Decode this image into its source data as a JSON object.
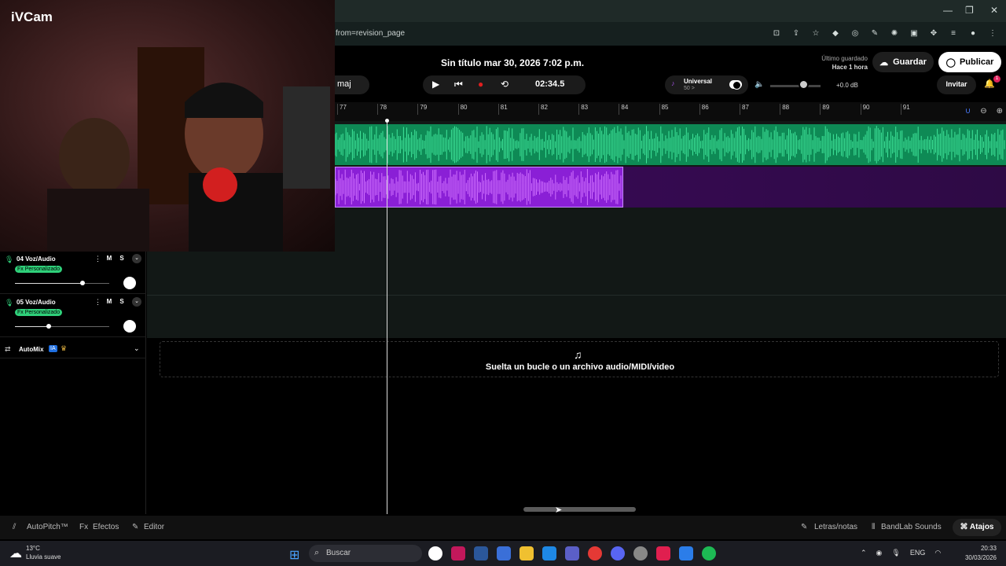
{
  "webcam": {
    "logo": "iVCam"
  },
  "browser": {
    "url": "from=revision_page",
    "minimize": "—",
    "restore": "❐",
    "close": "✕"
  },
  "header": {
    "title": "Sin título mar 30, 2026 7:02 p.m.",
    "saved_label": "Último guardado",
    "saved_time": "Hace 1 hora",
    "save_button": "Guardar",
    "publish_button": "Publicar",
    "key": "maj",
    "time": "02:34.5",
    "preset_name": "Universal",
    "preset_value": "50 >",
    "volume_db": "+0.0 dB",
    "volume_level": 0.6,
    "invite_button": "Invitar",
    "notif_count": "1"
  },
  "ruler": {
    "ticks": [
      "77",
      "78",
      "79",
      "80",
      "81",
      "82",
      "83",
      "84",
      "85",
      "86",
      "87",
      "88",
      "89",
      "90",
      "91"
    ]
  },
  "tracks": [
    {
      "name": "04  Voz/Audio",
      "fx": "Fx Personalizado",
      "mute": "M",
      "solo": "S",
      "volume": 0.72
    },
    {
      "name": "05  Voz/Audio",
      "fx": "Fx Personalizado",
      "mute": "M",
      "solo": "S",
      "volume": 0.36
    }
  ],
  "automix": {
    "label": "AutoMix",
    "ia": "IA"
  },
  "drop_zone": {
    "text": "Suelta un bucle o un archivo audio/MIDI/video"
  },
  "bottom_bar": {
    "autopitch": "AutoPitch™",
    "effects": "Efectos",
    "editor": "Editor",
    "lyrics": "Letras/notas",
    "sounds": "BandLab Sounds",
    "shortcuts": "Atajos"
  },
  "taskbar": {
    "temp": "13°C",
    "weather": "Lluvia suave",
    "search": "Buscar",
    "lang": "ENG",
    "time": "20:33",
    "date": "30/03/2026"
  },
  "colors": {
    "accent_green": "#2fd07a",
    "waveform_green": "#0e8a55",
    "clip_purple": "#8a1fd6"
  }
}
